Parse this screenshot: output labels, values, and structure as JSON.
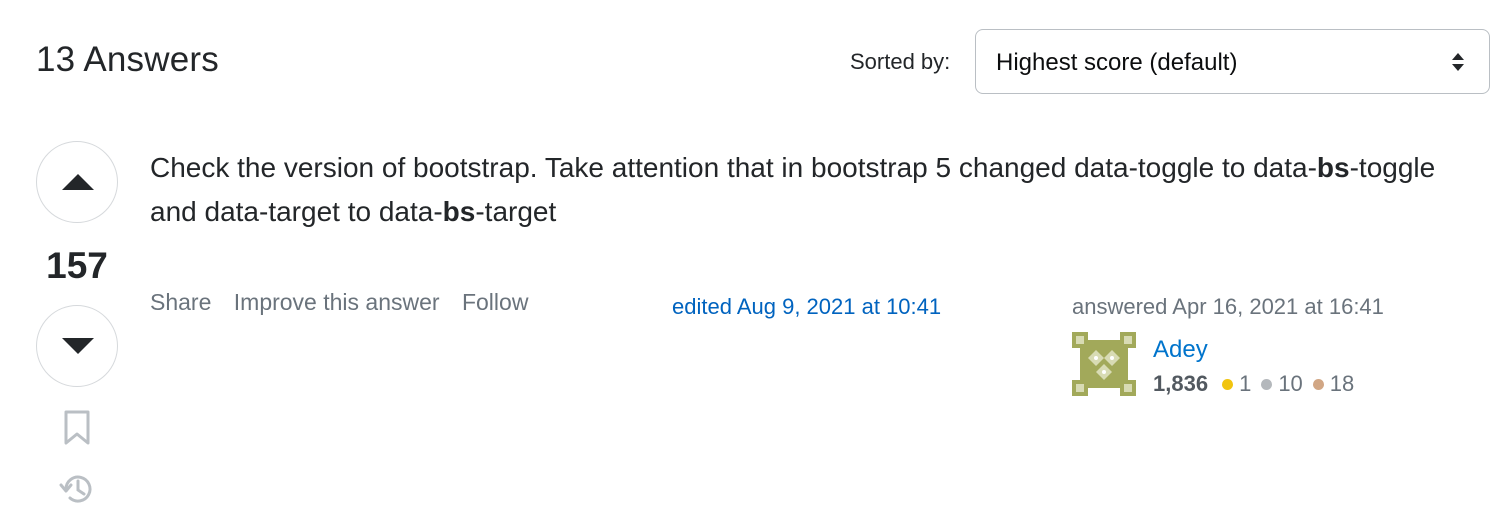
{
  "answers_header": {
    "count_label": "13 Answers",
    "sort_label": "Sorted by:",
    "sort_value": "Highest score (default)"
  },
  "vote": {
    "score": "157"
  },
  "answer": {
    "text_line1": "Check the version of bootstrap. Take attention that in bootstrap 5 changed data-toggle to data-",
    "bold1": "bs",
    "text_mid": "-toggle and data-target to data-",
    "bold2": "bs",
    "text_end": "-target"
  },
  "post_menu": {
    "share": "Share",
    "improve": "Improve this answer",
    "follow": "Follow"
  },
  "edited": {
    "label": "edited Aug 9, 2021 at 10:41"
  },
  "author": {
    "action_time": "answered Apr 16, 2021 at 16:41",
    "name": "Adey",
    "reputation": "1,836",
    "gold": "1",
    "silver": "10",
    "bronze": "18"
  },
  "colors": {
    "link": "#0063bf",
    "gold": "#f1c40f",
    "silver": "#b4b8bc",
    "bronze": "#d1a684",
    "avatar": "#a2a95a"
  },
  "icons": [
    "chevron-up-icon",
    "chevron-down-icon",
    "sort-arrows-icon",
    "bookmark-icon",
    "history-icon",
    "identicon-avatar"
  ]
}
